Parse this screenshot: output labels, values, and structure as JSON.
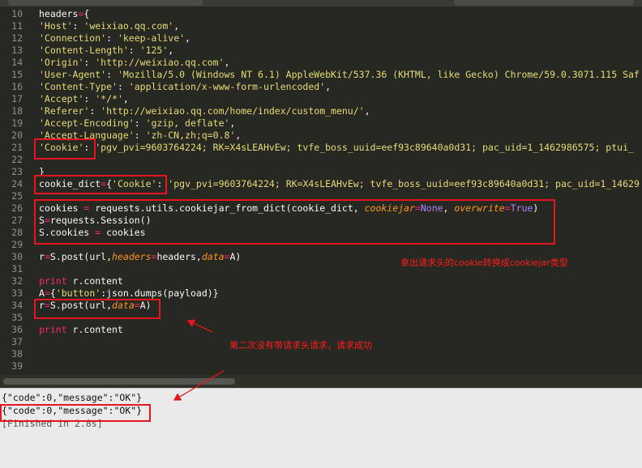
{
  "editor": {
    "lines": [
      {
        "n": "10",
        "html": "headers<span class=\"o\">=</span>{"
      },
      {
        "n": "11",
        "html": "<span class=\"s\">'Host'</span>: <span class=\"s\">'weixiao.qq.com'</span>,"
      },
      {
        "n": "12",
        "html": "<span class=\"s\">'Connection'</span>: <span class=\"s\">'keep-alive'</span>,"
      },
      {
        "n": "13",
        "html": "<span class=\"s\">'Content-Length'</span>: <span class=\"s\">'125'</span>,"
      },
      {
        "n": "14",
        "html": "<span class=\"s\">'Origin'</span>: <span class=\"s\">'http://weixiao.qq.com'</span>,"
      },
      {
        "n": "15",
        "html": "<span class=\"s\">'User-Agent'</span>: <span class=\"s\">'Mozilla/5.0 (Windows NT 6.1) AppleWebKit/537.36 (KHTML, like Gecko) Chrome/59.0.3071.115 Saf</span>"
      },
      {
        "n": "16",
        "html": "<span class=\"s\">'Content-Type'</span>: <span class=\"s\">'application/x-www-form-urlencoded'</span>,"
      },
      {
        "n": "17",
        "html": "<span class=\"s\">'Accept'</span>: <span class=\"s\">'*/*'</span>,"
      },
      {
        "n": "18",
        "html": "<span class=\"s\">'Referer'</span>: <span class=\"s\">'http://weixiao.qq.com/home/index/custom_menu/'</span>,"
      },
      {
        "n": "19",
        "html": "<span class=\"s\">'Accept-Encoding'</span>: <span class=\"s\">'gzip, deflate'</span>,"
      },
      {
        "n": "20",
        "html": "<span class=\"s\">'Accept-Language'</span>: <span class=\"s\">'zh-CN,zh;q=0.8'</span>,"
      },
      {
        "n": "21",
        "html": "<span class=\"s\">'Cookie'</span>: <span class=\"s\">'pgv_pvi=9603764224; RK=X4sLEAHvEw; tvfe_boss_uuid=eef93c89640a0d31; pac_uid=1_1462986575; ptui_</span>"
      },
      {
        "n": "22",
        "html": ""
      },
      {
        "n": "23",
        "html": "}"
      },
      {
        "n": "24",
        "html": "cookie_dict<span class=\"o\">=</span>{<span class=\"s\">'Cookie'</span>: <span class=\"s\">'pgv_pvi=9603764224; RK=X4sLEAHvEw; tvfe_boss_uuid=eef93c89640a0d31; pac_uid=1_14629</span>"
      },
      {
        "n": "25",
        "html": ""
      },
      {
        "n": "26",
        "html": "cookies <span class=\"o\">=</span> requests.utils.cookiejar_from_dict(cookie_dict, <span class=\"p\">cookiejar</span><span class=\"o\">=</span><span class=\"c\">None</span>, <span class=\"p\">overwrite</span><span class=\"o\">=</span><span class=\"c\">True</span>)"
      },
      {
        "n": "27",
        "html": "S<span class=\"o\">=</span>requests.Session()"
      },
      {
        "n": "28",
        "html": "S.cookies <span class=\"o\">=</span> cookies"
      },
      {
        "n": "29",
        "html": ""
      },
      {
        "n": "30",
        "html": "r<span class=\"o\">=</span>S.post(url,<span class=\"p\">headers</span><span class=\"o\">=</span>headers,<span class=\"p\">data</span><span class=\"o\">=</span>A)"
      },
      {
        "n": "31",
        "html": ""
      },
      {
        "n": "32",
        "html": "<span class=\"o\">print</span> r.content"
      },
      {
        "n": "33",
        "html": "A<span class=\"o\">=</span>{<span class=\"s\">'button'</span>:json.dumps(payload)}"
      },
      {
        "n": "34",
        "html": "r<span class=\"o\">=</span>S.post(url,<span class=\"p\">data</span><span class=\"o\">=</span>A)"
      },
      {
        "n": "35",
        "html": ""
      },
      {
        "n": "36",
        "html": "<span class=\"o\">print</span> r.content"
      },
      {
        "n": "37",
        "html": ""
      },
      {
        "n": "38",
        "html": ""
      },
      {
        "n": "39",
        "html": ""
      }
    ]
  },
  "annotations": {
    "cookie_to_jar": "拿出请求头的cookie转换成cookiejar类型",
    "second_request": "第二次没有带请求头请求，请求成功"
  },
  "console": {
    "lines": [
      "{\"code\":0,\"message\":\"OK\"}",
      "{\"code\":0,\"message\":\"OK\"}",
      "[Finished in 2.8s]"
    ]
  },
  "colors": {
    "editor_bg": "#272822",
    "highlight_red": "#e8141e",
    "console_bg": "#eaeaea"
  }
}
